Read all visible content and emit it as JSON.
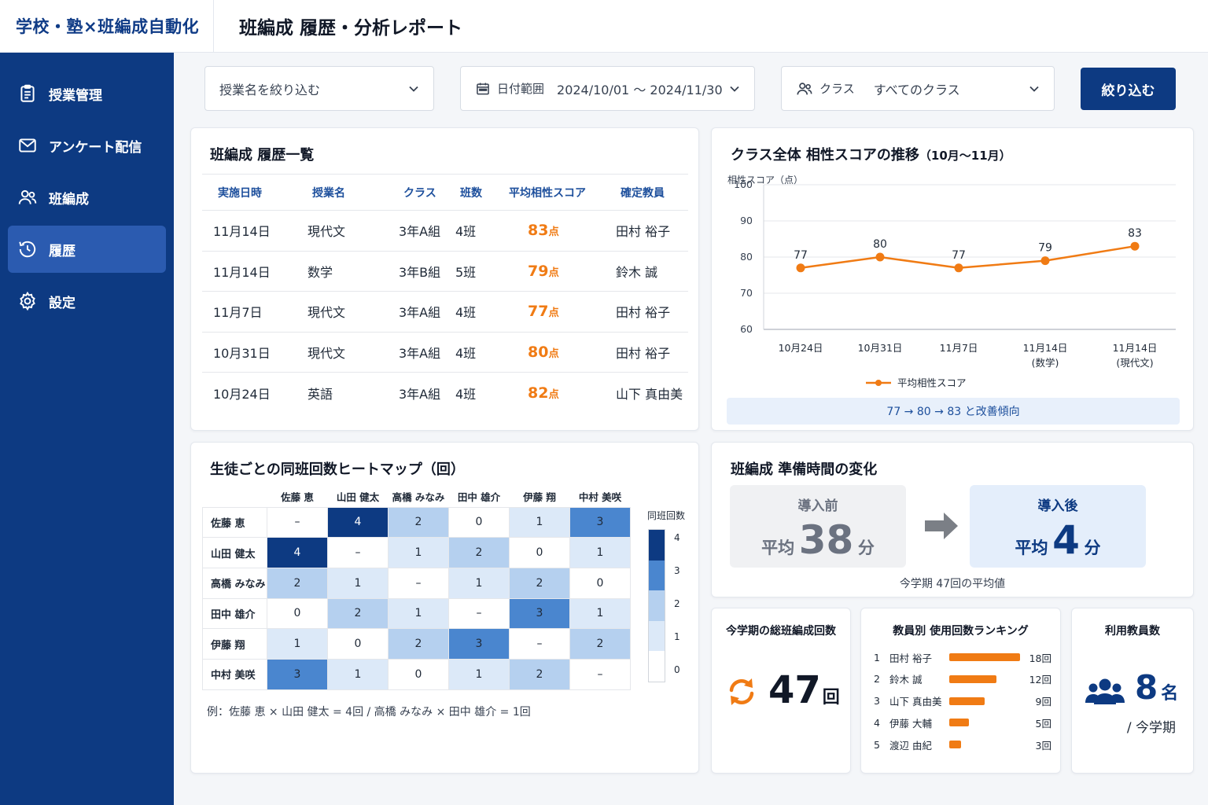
{
  "app": {
    "brand": "学校・塾×班編成自動化",
    "page_title": "班編成 履歴・分析レポート"
  },
  "sidebar": {
    "items": [
      {
        "label": "授業管理",
        "icon": "clipboard-icon"
      },
      {
        "label": "アンケート配信",
        "icon": "mail-icon"
      },
      {
        "label": "班編成",
        "icon": "users-icon"
      },
      {
        "label": "履歴",
        "icon": "history-icon",
        "active": true
      },
      {
        "label": "設定",
        "icon": "gear-icon"
      }
    ]
  },
  "filters": {
    "lesson": {
      "value": "授業名を絞り込む"
    },
    "date": {
      "label": "日付範囲",
      "value": "2024/10/01 〜 2024/11/30"
    },
    "class": {
      "label": "クラス",
      "value": "すべてのクラス"
    },
    "submit_label": "絞り込む"
  },
  "history": {
    "title": "班編成 履歴一覧",
    "columns": [
      "実施日時",
      "授業名",
      "クラス",
      "班数",
      "平均相性スコア",
      "確定教員"
    ],
    "score_unit": "点",
    "rows": [
      {
        "date": "11月14日",
        "subject": "現代文",
        "class": "3年A組",
        "groups": "4班",
        "score": "83",
        "teacher": "田村 裕子"
      },
      {
        "date": "11月14日",
        "subject": "数学",
        "class": "3年B組",
        "groups": "5班",
        "score": "79",
        "teacher": "鈴木 誠"
      },
      {
        "date": "11月7日",
        "subject": "現代文",
        "class": "3年A組",
        "groups": "4班",
        "score": "77",
        "teacher": "田村 裕子"
      },
      {
        "date": "10月31日",
        "subject": "現代文",
        "class": "3年A組",
        "groups": "4班",
        "score": "80",
        "teacher": "田村 裕子"
      },
      {
        "date": "10月24日",
        "subject": "英語",
        "class": "3年A組",
        "groups": "4班",
        "score": "82",
        "teacher": "山下 真由美"
      }
    ]
  },
  "trend": {
    "title": "クラス全体 相性スコアの推移",
    "title_suffix": "（10月〜11月）",
    "summary": "77 → 80 → 83 と改善傾向"
  },
  "chart_data": {
    "type": "line",
    "categories": [
      [
        "10月24日"
      ],
      [
        "10月31日"
      ],
      [
        "11月7日"
      ],
      [
        "11月14日",
        "(数学)"
      ],
      [
        "11月14日",
        "(現代文)"
      ]
    ],
    "series": [
      {
        "name": "平均相性スコア",
        "values": [
          77,
          80,
          77,
          79,
          83
        ],
        "color": "#f07b14"
      }
    ],
    "ylabel": "相性スコア（点）",
    "ylim": [
      60,
      100
    ],
    "yticks": [
      60,
      70,
      80,
      90,
      100
    ],
    "grid": true,
    "legend": "bottom"
  },
  "heatmap": {
    "title": "生徒ごとの同班回数ヒートマップ（回）",
    "students": [
      "佐藤 恵",
      "山田 健太",
      "高橋 みなみ",
      "田中 雄介",
      "伊藤 翔",
      "中村 美咲"
    ],
    "matrix": [
      [
        null,
        4,
        2,
        0,
        1,
        3
      ],
      [
        4,
        null,
        1,
        2,
        0,
        1
      ],
      [
        2,
        1,
        null,
        1,
        2,
        0
      ],
      [
        0,
        2,
        1,
        null,
        3,
        1
      ],
      [
        1,
        0,
        2,
        3,
        null,
        2
      ],
      [
        3,
        1,
        0,
        1,
        2,
        null
      ]
    ],
    "diagonal_symbol": "–",
    "legend_title": "同班回数",
    "legend_values": [
      "4",
      "3",
      "2",
      "1",
      "0"
    ],
    "colors": [
      "#ffffff",
      "#dce9f8",
      "#b5d0ef",
      "#4a86cf",
      "#0d3a82"
    ],
    "note": "例：佐藤 恵 × 山田 健太 = 4回 / 高橋 みなみ × 田中 雄介 = 1回"
  },
  "prep": {
    "title": "班編成 準備時間の変化",
    "before": {
      "label": "導入前",
      "prefix": "平均",
      "value": "38",
      "unit": "分"
    },
    "after": {
      "label": "導入後",
      "prefix": "平均",
      "value": "4",
      "unit": "分"
    },
    "note": "今学期 47回の平均値"
  },
  "total": {
    "title": "今学期の総班編成回数",
    "value": "47",
    "unit": "回"
  },
  "ranking": {
    "title": "教員別 使用回数ランキング",
    "max": 18,
    "items": [
      {
        "rank": "1",
        "name": "田村 裕子",
        "count": 18,
        "count_label": "18回"
      },
      {
        "rank": "2",
        "name": "鈴木 誠",
        "count": 12,
        "count_label": "12回"
      },
      {
        "rank": "3",
        "name": "山下 真由美",
        "count": 9,
        "count_label": "9回"
      },
      {
        "rank": "4",
        "name": "伊藤 大輔",
        "count": 5,
        "count_label": "5回"
      },
      {
        "rank": "5",
        "name": "渡辺 由紀",
        "count": 3,
        "count_label": "3回"
      }
    ]
  },
  "teachers": {
    "title": "利用教員数",
    "value": "8",
    "unit": "名",
    "sub": "/ 今学期"
  }
}
